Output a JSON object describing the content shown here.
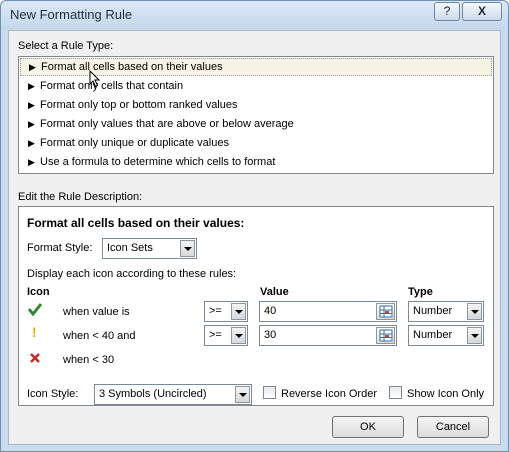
{
  "window": {
    "title": "New Formatting Rule",
    "help_label": "?",
    "close_label": "X"
  },
  "rule_type": {
    "section_label": "Select a Rule Type:",
    "items": [
      "Format all cells based on their values",
      "Format only cells that contain",
      "Format only top or bottom ranked values",
      "Format only values that are above or below average",
      "Format only unique or duplicate values",
      "Use a formula to determine which cells to format"
    ],
    "selected_index": 0
  },
  "description": {
    "section_label": "Edit the Rule Description:",
    "heading": "Format all cells based on their values:",
    "format_style_label": "Format Style:",
    "format_style_value": "Icon Sets",
    "display_text": "Display each icon according to these rules:",
    "columns": {
      "icon": "Icon",
      "value": "Value",
      "type": "Type"
    },
    "rules": [
      {
        "icon": "green-check-icon",
        "icon_color": "#2e8b2e",
        "condition": "when value is",
        "operator": ">=",
        "value": "40",
        "type": "Number"
      },
      {
        "icon": "yellow-exclamation-icon",
        "icon_color": "#e8b400",
        "condition": "when < 40 and",
        "operator": ">=",
        "value": "30",
        "type": "Number"
      },
      {
        "icon": "red-x-icon",
        "icon_color": "#c8281e",
        "condition": "when < 30"
      }
    ],
    "icon_style_label": "Icon Style:",
    "icon_style_value": "3 Symbols (Uncircled)",
    "reverse_icon_order_label": "Reverse Icon Order",
    "reverse_icon_order_checked": false,
    "show_icon_only_label": "Show Icon Only",
    "show_icon_only_checked": false
  },
  "buttons": {
    "ok_label": "OK",
    "cancel_label": "Cancel"
  }
}
